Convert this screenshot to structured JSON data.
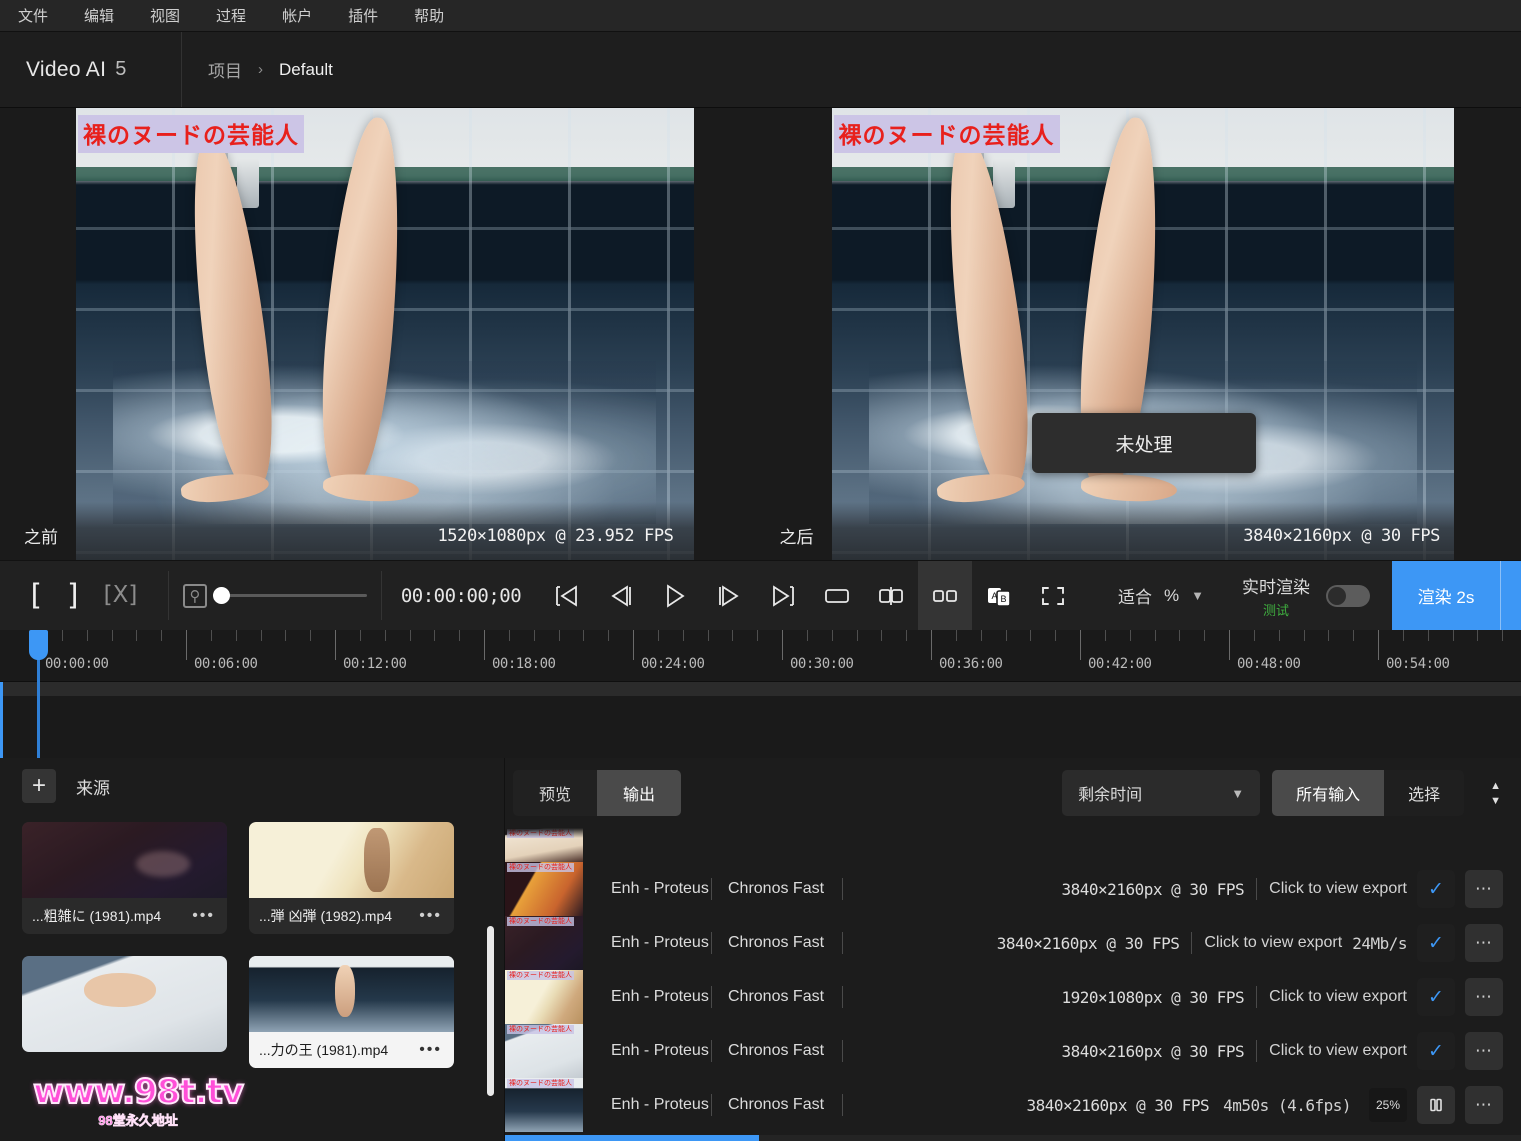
{
  "menubar": {
    "items": [
      {
        "label": "文件"
      },
      {
        "label": "编辑"
      },
      {
        "label": "视图"
      },
      {
        "label": "过程"
      },
      {
        "label": "帐户"
      },
      {
        "label": "插件"
      },
      {
        "label": "帮助"
      }
    ]
  },
  "titlebar": {
    "app_name": "Video AI",
    "app_version": "5",
    "breadcrumb_root": "项目",
    "breadcrumb_separator": "›",
    "breadcrumb_current": "Default"
  },
  "viewer": {
    "before": {
      "label": "之前",
      "resolution": "1520×1080px @ 23.952 FPS",
      "overlay_caption": "裸のヌードの芸能人"
    },
    "after": {
      "label": "之后",
      "resolution": "3840×2160px @ 30 FPS",
      "overlay_caption": "裸のヌードの芸能人"
    },
    "tooltip": "未处理"
  },
  "transport": {
    "mark_in": "[",
    "mark_out": "]",
    "clear_marks": "[X]",
    "zoom_icon": "zoom-icon",
    "timecode": "00:00;00;00",
    "timecode_display": "00:00:00;00",
    "fit_label": "适合",
    "fit_unit": "%",
    "live_render_label": "实时渲染",
    "live_render_badge": "测试",
    "live_render_on": false,
    "render_button": "渲染 2s"
  },
  "timeline": {
    "ticks": [
      "00:00:00",
      "00:06:00",
      "00:12:00",
      "00:18:00",
      "00:24:00",
      "00:30:00",
      "00:36:00",
      "00:42:00",
      "00:48:00",
      "00:54:00"
    ],
    "playhead_position": "00:00:00"
  },
  "sources": {
    "add_label": "+",
    "title": "来源",
    "items": [
      {
        "name": "...粗雑に (1981).mp4",
        "menu": "•••",
        "selected": false,
        "art": "th-a"
      },
      {
        "name": "...弾 凶弾 (1982).mp4",
        "menu": "•••",
        "selected": false,
        "art": "th-b"
      },
      {
        "name": "",
        "menu": "",
        "selected": false,
        "art": "th-c"
      },
      {
        "name": "...力の王 (1981).mp4",
        "menu": "•••",
        "selected": true,
        "art": "th-d"
      }
    ]
  },
  "watermark": {
    "main": "www.98t.tv",
    "sub": "98堂永久地址"
  },
  "output": {
    "tabs": [
      {
        "label": "预览",
        "active": false
      },
      {
        "label": "输出",
        "active": true
      }
    ],
    "remaining_time_label": "剩余时间",
    "filter_all_label": "所有输入",
    "filter_select_label": "选择",
    "sort_up": "▲",
    "sort_down": "▼",
    "rows": [
      {
        "model": "",
        "speed": "",
        "resolution": "",
        "view_export": "",
        "bitrate": "",
        "eta": "",
        "percent": "",
        "status": "partial",
        "thumb": "rt-1",
        "tag": "裸のヌードの芸能人"
      },
      {
        "model": "Enh - Proteus",
        "speed": "Chronos Fast",
        "resolution": "3840×2160px @ 30 FPS",
        "view_export": "Click to view export",
        "bitrate": "",
        "eta": "",
        "percent": "",
        "status": "done",
        "thumb": "rt-2",
        "tag": "裸のヌードの芸能人"
      },
      {
        "model": "Enh - Proteus",
        "speed": "Chronos Fast",
        "resolution": "3840×2160px @ 30 FPS",
        "view_export": "Click to view export",
        "bitrate": "24Mb/s",
        "eta": "",
        "percent": "",
        "status": "done",
        "thumb": "rt-3",
        "tag": "裸のヌードの芸能人"
      },
      {
        "model": "Enh - Proteus",
        "speed": "Chronos Fast",
        "resolution": "1920×1080px @ 30 FPS",
        "view_export": "Click to view export",
        "bitrate": "",
        "eta": "",
        "percent": "",
        "status": "done",
        "thumb": "rt-4",
        "tag": "裸のヌードの芸能人"
      },
      {
        "model": "Enh - Proteus",
        "speed": "Chronos Fast",
        "resolution": "3840×2160px @ 30 FPS",
        "view_export": "Click to view export",
        "bitrate": "",
        "eta": "",
        "percent": "",
        "status": "done",
        "thumb": "rt-5",
        "tag": "裸のヌードの芸能人"
      },
      {
        "model": "Enh - Proteus",
        "speed": "Chronos Fast",
        "resolution": "3840×2160px @ 30 FPS",
        "view_export": "",
        "bitrate": "",
        "eta": "4m50s (4.6fps)",
        "percent": "25%",
        "status": "running",
        "thumb": "rt-6",
        "tag": "裸のヌードの芸能人"
      }
    ],
    "progress_percent": 25
  },
  "colors": {
    "accent_blue": "#3d97f5",
    "badge_green": "#3fae3f",
    "caption_red": "#e8201c",
    "caption_bg": "#ccc5e6",
    "panel_bg": "#1c1c1c"
  }
}
